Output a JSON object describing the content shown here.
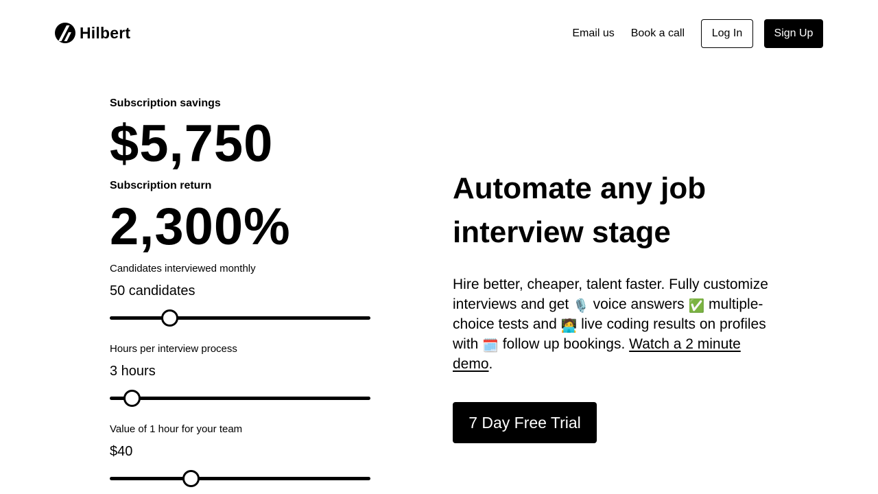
{
  "header": {
    "brand": {
      "name": "Hilbert",
      "logo_icon": "hilbert-logo-icon"
    },
    "nav": {
      "email_us": "Email us",
      "book_call": "Book a call",
      "log_in": "Log In",
      "sign_up": "Sign Up"
    }
  },
  "calculator": {
    "savings": {
      "label": "Subscription savings",
      "value": "$5,750"
    },
    "return": {
      "label": "Subscription return",
      "value": "2,300%"
    },
    "inputs": [
      {
        "label": "Candidates interviewed monthly",
        "value": "50 candidates",
        "position": 0.23
      },
      {
        "label": "Hours per interview process",
        "value": "3 hours",
        "position": 0.085
      },
      {
        "label": "Value of 1 hour for your team",
        "value": "$40",
        "position": 0.31
      }
    ]
  },
  "hero": {
    "title": "Automate any job interview stage",
    "desc": {
      "part1": "Hire better, cheaper, talent faster. Fully customize interviews and get ",
      "emoji1": "🎙️",
      "part2": " voice answers ",
      "emoji2": "✅",
      "part3": " multiple-choice tests and ",
      "emoji3": "🧑‍💻",
      "part4": " live coding results on profiles with ",
      "emoji4": "🗓️",
      "part5": " follow up bookings. ",
      "link": "Watch a 2 minute demo",
      "end": "."
    },
    "cta": "7 Day Free Trial"
  }
}
